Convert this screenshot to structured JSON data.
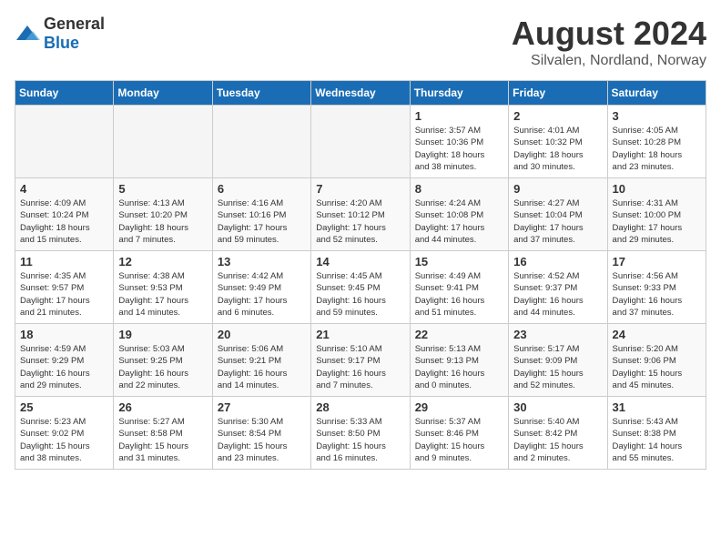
{
  "logo": {
    "general": "General",
    "blue": "Blue"
  },
  "title": {
    "month_year": "August 2024",
    "location": "Silvalen, Nordland, Norway"
  },
  "days_of_week": [
    "Sunday",
    "Monday",
    "Tuesday",
    "Wednesday",
    "Thursday",
    "Friday",
    "Saturday"
  ],
  "weeks": [
    [
      {
        "day": "",
        "info": "",
        "empty": true
      },
      {
        "day": "",
        "info": "",
        "empty": true
      },
      {
        "day": "",
        "info": "",
        "empty": true
      },
      {
        "day": "",
        "info": "",
        "empty": true
      },
      {
        "day": "1",
        "info": "Sunrise: 3:57 AM\nSunset: 10:36 PM\nDaylight: 18 hours\nand 38 minutes.",
        "empty": false
      },
      {
        "day": "2",
        "info": "Sunrise: 4:01 AM\nSunset: 10:32 PM\nDaylight: 18 hours\nand 30 minutes.",
        "empty": false
      },
      {
        "day": "3",
        "info": "Sunrise: 4:05 AM\nSunset: 10:28 PM\nDaylight: 18 hours\nand 23 minutes.",
        "empty": false
      }
    ],
    [
      {
        "day": "4",
        "info": "Sunrise: 4:09 AM\nSunset: 10:24 PM\nDaylight: 18 hours\nand 15 minutes.",
        "empty": false
      },
      {
        "day": "5",
        "info": "Sunrise: 4:13 AM\nSunset: 10:20 PM\nDaylight: 18 hours\nand 7 minutes.",
        "empty": false
      },
      {
        "day": "6",
        "info": "Sunrise: 4:16 AM\nSunset: 10:16 PM\nDaylight: 17 hours\nand 59 minutes.",
        "empty": false
      },
      {
        "day": "7",
        "info": "Sunrise: 4:20 AM\nSunset: 10:12 PM\nDaylight: 17 hours\nand 52 minutes.",
        "empty": false
      },
      {
        "day": "8",
        "info": "Sunrise: 4:24 AM\nSunset: 10:08 PM\nDaylight: 17 hours\nand 44 minutes.",
        "empty": false
      },
      {
        "day": "9",
        "info": "Sunrise: 4:27 AM\nSunset: 10:04 PM\nDaylight: 17 hours\nand 37 minutes.",
        "empty": false
      },
      {
        "day": "10",
        "info": "Sunrise: 4:31 AM\nSunset: 10:00 PM\nDaylight: 17 hours\nand 29 minutes.",
        "empty": false
      }
    ],
    [
      {
        "day": "11",
        "info": "Sunrise: 4:35 AM\nSunset: 9:57 PM\nDaylight: 17 hours\nand 21 minutes.",
        "empty": false
      },
      {
        "day": "12",
        "info": "Sunrise: 4:38 AM\nSunset: 9:53 PM\nDaylight: 17 hours\nand 14 minutes.",
        "empty": false
      },
      {
        "day": "13",
        "info": "Sunrise: 4:42 AM\nSunset: 9:49 PM\nDaylight: 17 hours\nand 6 minutes.",
        "empty": false
      },
      {
        "day": "14",
        "info": "Sunrise: 4:45 AM\nSunset: 9:45 PM\nDaylight: 16 hours\nand 59 minutes.",
        "empty": false
      },
      {
        "day": "15",
        "info": "Sunrise: 4:49 AM\nSunset: 9:41 PM\nDaylight: 16 hours\nand 51 minutes.",
        "empty": false
      },
      {
        "day": "16",
        "info": "Sunrise: 4:52 AM\nSunset: 9:37 PM\nDaylight: 16 hours\nand 44 minutes.",
        "empty": false
      },
      {
        "day": "17",
        "info": "Sunrise: 4:56 AM\nSunset: 9:33 PM\nDaylight: 16 hours\nand 37 minutes.",
        "empty": false
      }
    ],
    [
      {
        "day": "18",
        "info": "Sunrise: 4:59 AM\nSunset: 9:29 PM\nDaylight: 16 hours\nand 29 minutes.",
        "empty": false
      },
      {
        "day": "19",
        "info": "Sunrise: 5:03 AM\nSunset: 9:25 PM\nDaylight: 16 hours\nand 22 minutes.",
        "empty": false
      },
      {
        "day": "20",
        "info": "Sunrise: 5:06 AM\nSunset: 9:21 PM\nDaylight: 16 hours\nand 14 minutes.",
        "empty": false
      },
      {
        "day": "21",
        "info": "Sunrise: 5:10 AM\nSunset: 9:17 PM\nDaylight: 16 hours\nand 7 minutes.",
        "empty": false
      },
      {
        "day": "22",
        "info": "Sunrise: 5:13 AM\nSunset: 9:13 PM\nDaylight: 16 hours\nand 0 minutes.",
        "empty": false
      },
      {
        "day": "23",
        "info": "Sunrise: 5:17 AM\nSunset: 9:09 PM\nDaylight: 15 hours\nand 52 minutes.",
        "empty": false
      },
      {
        "day": "24",
        "info": "Sunrise: 5:20 AM\nSunset: 9:06 PM\nDaylight: 15 hours\nand 45 minutes.",
        "empty": false
      }
    ],
    [
      {
        "day": "25",
        "info": "Sunrise: 5:23 AM\nSunset: 9:02 PM\nDaylight: 15 hours\nand 38 minutes.",
        "empty": false
      },
      {
        "day": "26",
        "info": "Sunrise: 5:27 AM\nSunset: 8:58 PM\nDaylight: 15 hours\nand 31 minutes.",
        "empty": false
      },
      {
        "day": "27",
        "info": "Sunrise: 5:30 AM\nSunset: 8:54 PM\nDaylight: 15 hours\nand 23 minutes.",
        "empty": false
      },
      {
        "day": "28",
        "info": "Sunrise: 5:33 AM\nSunset: 8:50 PM\nDaylight: 15 hours\nand 16 minutes.",
        "empty": false
      },
      {
        "day": "29",
        "info": "Sunrise: 5:37 AM\nSunset: 8:46 PM\nDaylight: 15 hours\nand 9 minutes.",
        "empty": false
      },
      {
        "day": "30",
        "info": "Sunrise: 5:40 AM\nSunset: 8:42 PM\nDaylight: 15 hours\nand 2 minutes.",
        "empty": false
      },
      {
        "day": "31",
        "info": "Sunrise: 5:43 AM\nSunset: 8:38 PM\nDaylight: 14 hours\nand 55 minutes.",
        "empty": false
      }
    ]
  ]
}
